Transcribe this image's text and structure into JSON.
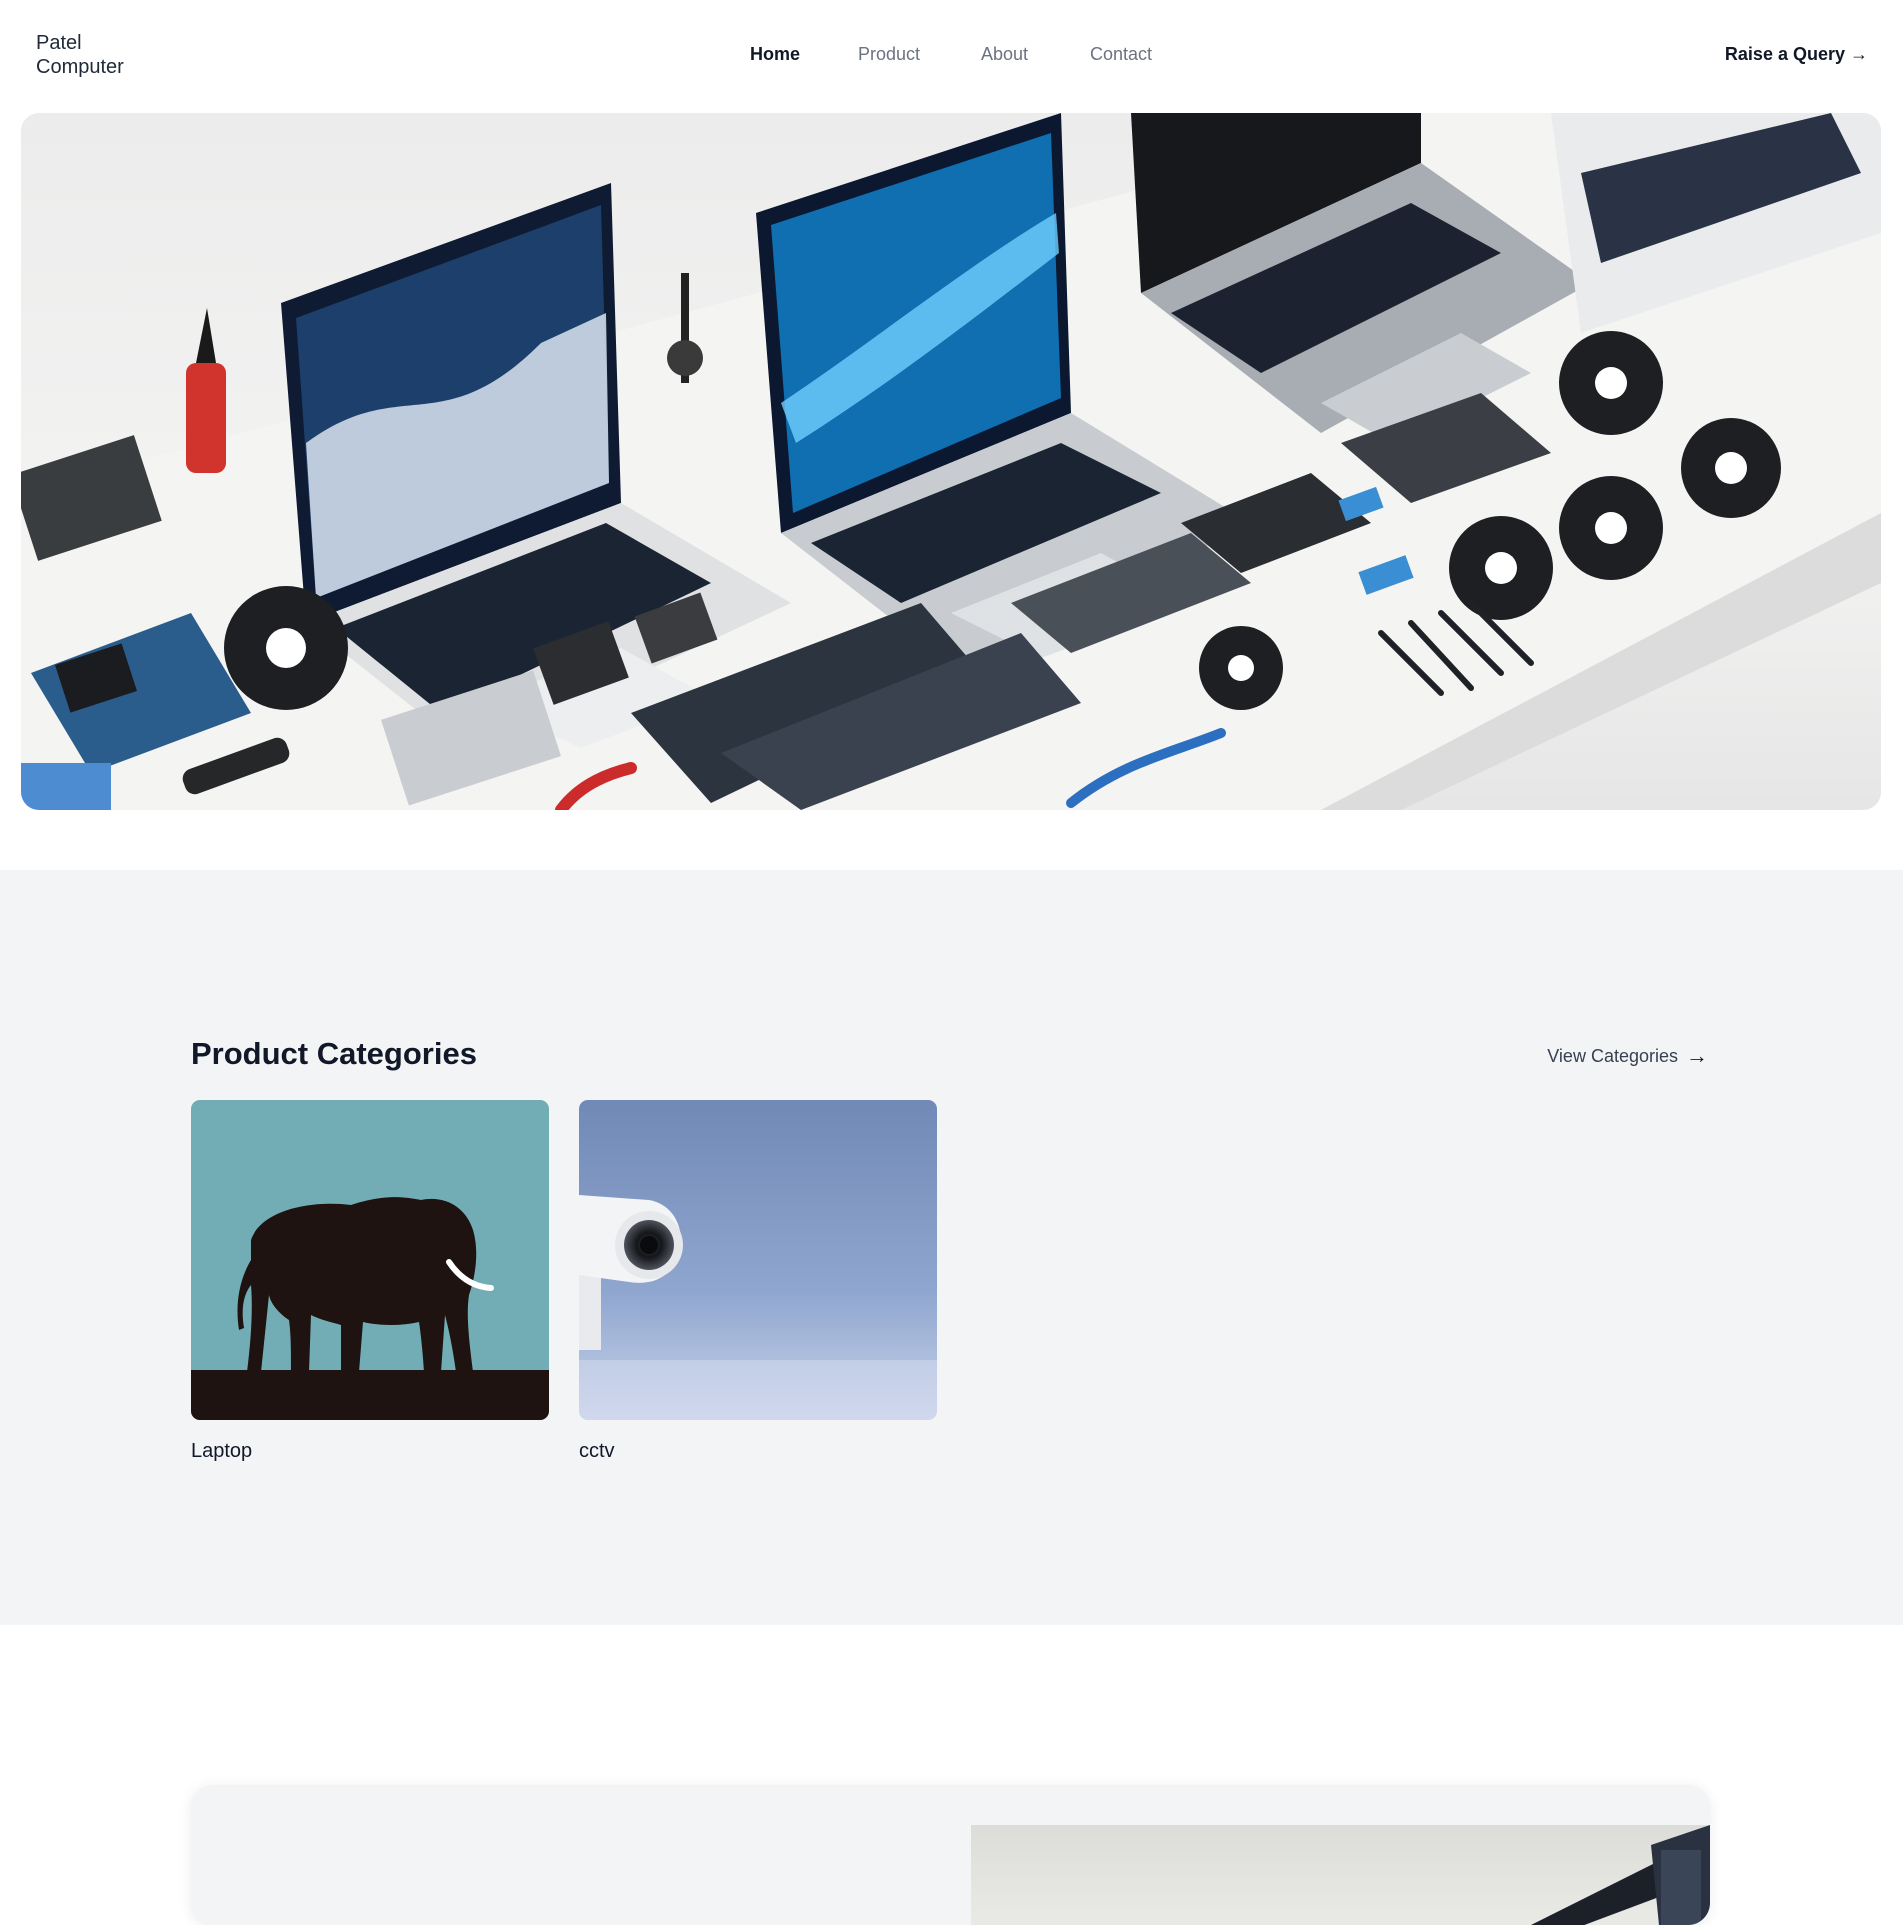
{
  "header": {
    "logo": "Patel Computer",
    "nav": [
      {
        "label": "Home",
        "active": true
      },
      {
        "label": "Product",
        "active": false
      },
      {
        "label": "About",
        "active": false
      },
      {
        "label": "Contact",
        "active": false
      }
    ],
    "cta_label": "Raise a Query →"
  },
  "hero": {
    "icon": "hero-laptops-parts-image"
  },
  "categories": {
    "title": "Product Categories",
    "view_label": "View Categories",
    "view_icon": "arrow-right-icon",
    "items": [
      {
        "label": "Laptop",
        "icon": "elephant-image"
      },
      {
        "label": "cctv",
        "icon": "cctv-camera-image"
      }
    ]
  },
  "colors": {
    "section_bg": "#f3f4f6",
    "card_teal": "#72adb5",
    "text": "#111827",
    "muted": "#6b7280"
  }
}
